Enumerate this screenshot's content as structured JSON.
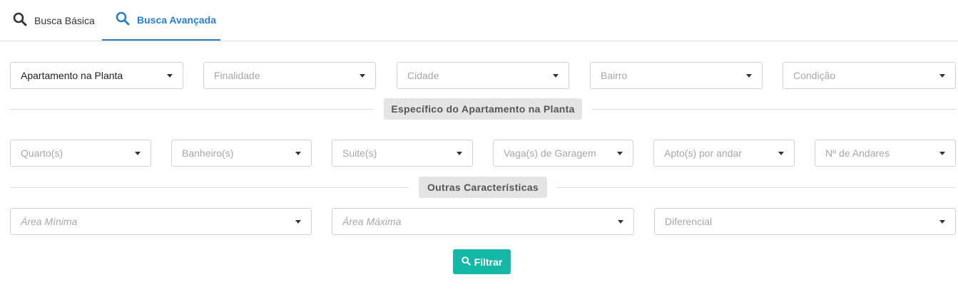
{
  "tabs": {
    "basic_label": "Busca Básica",
    "advanced_label": "Busca Avançada"
  },
  "row1": {
    "tipo_value": "Apartamento na Planta",
    "finalidade_placeholder": "Finalidade",
    "cidade_placeholder": "Cidade",
    "bairro_placeholder": "Bairro",
    "condicao_placeholder": "Condição"
  },
  "section_specific_label": "Específico do Apartamento na Planta",
  "row2": {
    "quartos_placeholder": "Quarto(s)",
    "banheiros_placeholder": "Banheiro(s)",
    "suites_placeholder": "Suite(s)",
    "vagas_placeholder": "Vaga(s) de Garagem",
    "aptos_placeholder": "Apto(s) por andar",
    "andares_placeholder": "Nº de Andares"
  },
  "section_other_label": "Outras Características",
  "row3": {
    "area_min_placeholder": "Área Mínima",
    "area_max_placeholder": "Área Máxima",
    "diferencial_placeholder": "Diferencial"
  },
  "filter_button_label": "Filtrar",
  "colors": {
    "accent_blue": "#2a7ec1",
    "button_teal": "#15b7a6"
  },
  "icons": {
    "tab_basic": "search-icon",
    "tab_advanced": "search-icon",
    "filter_button": "search-icon",
    "select_caret": "caret-down-icon"
  }
}
